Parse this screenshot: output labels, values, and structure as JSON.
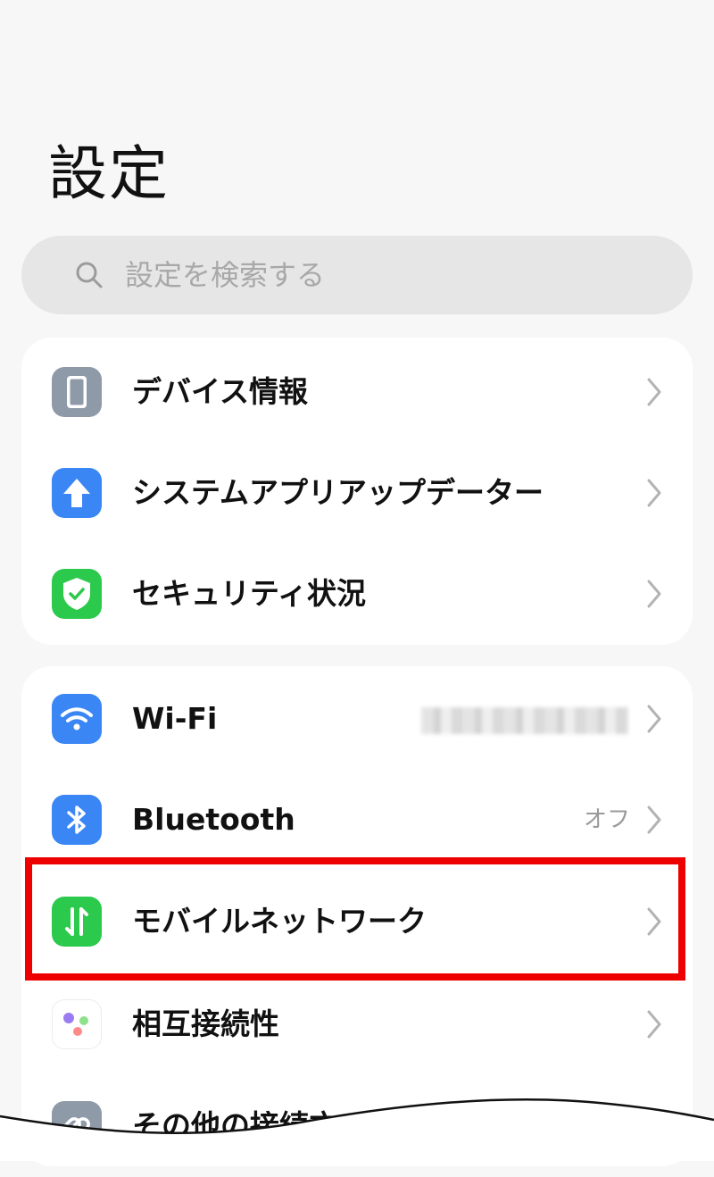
{
  "header": {
    "title": "設定"
  },
  "search": {
    "placeholder": "設定を検索する",
    "icon": "search-icon"
  },
  "groups": [
    {
      "items": [
        {
          "label": "デバイス情報",
          "icon": "phone-device-icon",
          "icon_color": "#8f9aa9"
        },
        {
          "label": "システムアプリアップデーター",
          "icon": "arrow-up-icon",
          "icon_color": "#3a86f5"
        },
        {
          "label": "セキュリティ状況",
          "icon": "shield-check-icon",
          "icon_color": "#2bc94c"
        }
      ]
    },
    {
      "items": [
        {
          "label": "Wi-Fi",
          "icon": "wifi-icon",
          "icon_color": "#3a86f5",
          "value": ""
        },
        {
          "label": "Bluetooth",
          "icon": "bluetooth-icon",
          "icon_color": "#3a86f5",
          "value": "オフ"
        },
        {
          "label": "モバイルネットワーク",
          "icon": "mobile-data-icon",
          "icon_color": "#2bc94c",
          "highlighted": true
        },
        {
          "label": "相互接続性",
          "icon": "connectivity-dots-icon",
          "icon_color": "#ffffff"
        },
        {
          "label": "その他の接続方",
          "icon": "link-icon",
          "icon_color": "#8f9aa9"
        }
      ]
    }
  ],
  "colors": {
    "highlight": "#ee0000",
    "background": "#f7f7f7",
    "accent_blue": "#3a86f5",
    "accent_green": "#2bc94c"
  }
}
